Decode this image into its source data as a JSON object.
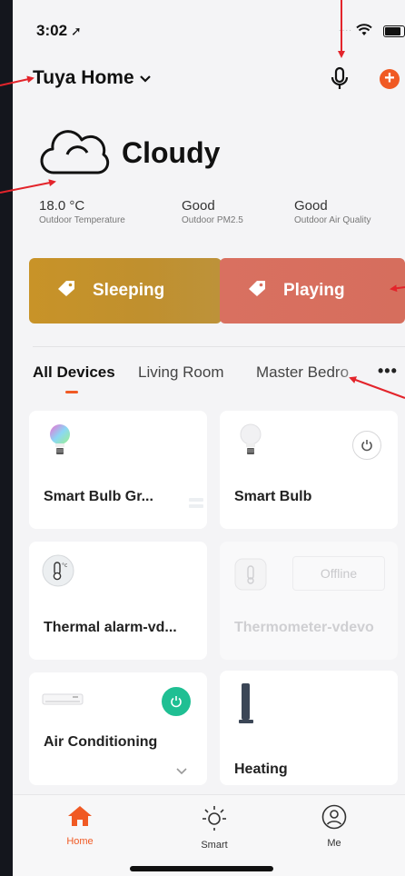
{
  "status_bar": {
    "time": "3:02",
    "dots": "...."
  },
  "header": {
    "home_name": "Tuya Home"
  },
  "weather": {
    "condition": "Cloudy",
    "stats": [
      {
        "value": "18.0 °C",
        "label": "Outdoor Temperature"
      },
      {
        "value": "Good",
        "label": "Outdoor PM2.5"
      },
      {
        "value": "Good",
        "label": "Outdoor Air Quality"
      }
    ]
  },
  "scenes": [
    {
      "name": "Sleeping",
      "color": "#c89328"
    },
    {
      "name": "Playing",
      "color": "#d97060"
    }
  ],
  "tabs": [
    {
      "label": "All Devices"
    },
    {
      "label": "Living Room"
    },
    {
      "label": "Master Bedro"
    }
  ],
  "more_label": "•••",
  "devices": [
    {
      "name": "Smart Bulb Gr...",
      "icon": "rgb-bulb-icon"
    },
    {
      "name": "Smart Bulb",
      "icon": "white-bulb-icon"
    },
    {
      "name": "Thermal alarm-vd...",
      "icon": "thermometer-icon"
    },
    {
      "name": "Thermometer-vdevo",
      "icon": "thermometer-icon",
      "status": "Offline"
    },
    {
      "name": "Air Conditioning",
      "icon": "air-conditioner-icon"
    },
    {
      "name": "Heating",
      "icon": "heater-icon"
    }
  ],
  "bottom_nav": [
    {
      "label": "Home",
      "icon": "home-icon"
    },
    {
      "label": "Smart",
      "icon": "sun-icon"
    },
    {
      "label": "Me",
      "icon": "profile-icon"
    }
  ],
  "colors": {
    "accent": "#f05a24",
    "power_on": "#1fbf93",
    "annotation": "#e3242b"
  }
}
